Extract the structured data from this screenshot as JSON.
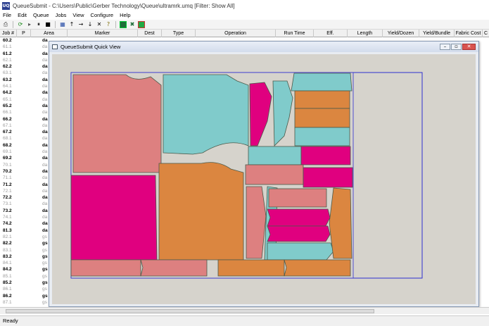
{
  "window": {
    "app_icon": "UQ",
    "title": "QueueSubmit - C:\\Users\\Public\\Gerber Technology\\Queue\\ultramrk.umq  [Filter: Show All]"
  },
  "menu": [
    "File",
    "Edit",
    "Queue",
    "Jobs",
    "View",
    "Configure",
    "Help"
  ],
  "toolbar": {
    "icons": [
      "print-icon",
      "refresh-icon",
      "play-icon",
      "pause-icon",
      "stop-icon",
      "grid-icon",
      "arrow-up-icon",
      "arrow-right-icon",
      "arrow-down-icon",
      "cancel-x-icon",
      "help-icon",
      "marker-view-icon",
      "marker-delete-icon",
      "marker-export-icon"
    ]
  },
  "table": {
    "columns": [
      "Job #",
      "P",
      "Area",
      "Marker",
      "Dest",
      "Type",
      "Operation",
      "Run Time",
      "Eff.",
      "Length",
      "Yield/Dozen",
      "Yield/Bundle",
      "Fabric Cost",
      "C"
    ],
    "rows": [
      {
        "job": "60.2",
        "area": "da",
        "dim": false
      },
      {
        "job": "61.1",
        "area": "da",
        "dim": true
      },
      {
        "job": "61.2",
        "area": "da",
        "dim": false
      },
      {
        "job": "62.1",
        "area": "da",
        "dim": true
      },
      {
        "job": "62.2",
        "area": "da",
        "dim": false
      },
      {
        "job": "63.1",
        "area": "da",
        "dim": true
      },
      {
        "job": "63.2",
        "area": "da",
        "dim": false
      },
      {
        "job": "64.1",
        "area": "da",
        "dim": true
      },
      {
        "job": "64.2",
        "area": "da",
        "dim": false
      },
      {
        "job": "65.1",
        "area": "da",
        "dim": true
      },
      {
        "job": "65.2",
        "area": "da",
        "dim": false
      },
      {
        "job": "66.1",
        "area": "da",
        "dim": true
      },
      {
        "job": "66.2",
        "area": "da",
        "dim": false
      },
      {
        "job": "67.1",
        "area": "da",
        "dim": true
      },
      {
        "job": "67.2",
        "area": "da",
        "dim": false
      },
      {
        "job": "68.1",
        "area": "da",
        "dim": true
      },
      {
        "job": "68.2",
        "area": "da",
        "dim": false
      },
      {
        "job": "69.1",
        "area": "da",
        "dim": true
      },
      {
        "job": "69.2",
        "area": "da",
        "dim": false
      },
      {
        "job": "70.1",
        "area": "da",
        "dim": true
      },
      {
        "job": "70.2",
        "area": "da",
        "dim": false
      },
      {
        "job": "71.1",
        "area": "da",
        "dim": true
      },
      {
        "job": "71.2",
        "area": "da",
        "dim": false
      },
      {
        "job": "72.1",
        "area": "da",
        "dim": true
      },
      {
        "job": "72.2",
        "area": "da",
        "dim": false
      },
      {
        "job": "73.1",
        "area": "da",
        "dim": true
      },
      {
        "job": "73.2",
        "area": "da",
        "dim": false
      },
      {
        "job": "74.1",
        "area": "da",
        "dim": true
      },
      {
        "job": "74.2",
        "area": "da",
        "dim": false
      },
      {
        "job": "81.3",
        "area": "da",
        "dim": false
      },
      {
        "job": "82.1",
        "area": "gs",
        "dim": true
      },
      {
        "job": "82.2",
        "area": "gs",
        "dim": false
      },
      {
        "job": "83.1",
        "area": "gs",
        "dim": true
      },
      {
        "job": "83.2",
        "area": "gs",
        "dim": false
      },
      {
        "job": "84.1",
        "area": "gs",
        "dim": true
      },
      {
        "job": "84.2",
        "area": "gs",
        "dim": false
      },
      {
        "job": "85.1",
        "area": "gs",
        "dim": true
      },
      {
        "job": "85.2",
        "area": "gs",
        "dim": false
      },
      {
        "job": "86.1",
        "area": "gs",
        "dim": true
      },
      {
        "job": "86.2",
        "area": "gs",
        "dim": false
      },
      {
        "job": "87.1",
        "area": "gs",
        "dim": true
      }
    ]
  },
  "quick_view": {
    "title": "QueueSubmit Quick View",
    "controls": {
      "minimize": "–",
      "restore": "▫",
      "close": "✕"
    },
    "colors": {
      "pink": "#dd8080",
      "teal": "#80cbcb",
      "magenta": "#e0007f",
      "orange": "#db8640",
      "canvas_bg": "#d6d3cc",
      "border_blue": "#2f2fd0"
    }
  },
  "statusbar": {
    "text": "Ready"
  }
}
